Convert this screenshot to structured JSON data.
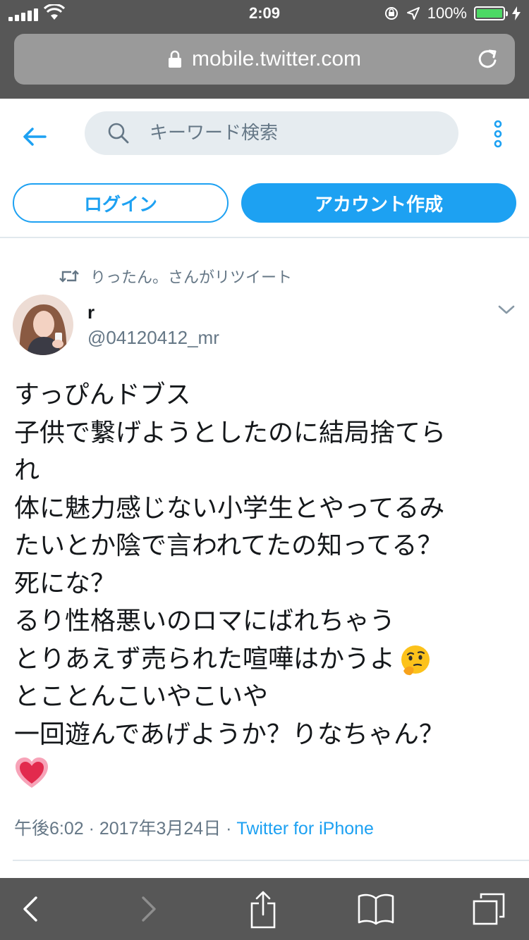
{
  "status_bar": {
    "time": "2:09",
    "battery": "100%"
  },
  "browser": {
    "url": "mobile.twitter.com"
  },
  "header": {
    "search_placeholder": "キーワード検索",
    "login_label": "ログイン",
    "signup_label": "アカウント作成"
  },
  "tweet": {
    "retweet_context": "りったん。さんがリツイート",
    "author_name": "r",
    "author_handle": "@04120412_mr",
    "lines": [
      "すっぴんドブス",
      "子供で繋げようとしたのに結局捨てら",
      "れ",
      "体に魅力感じない小学生とやってるみ",
      "たいとか陰で言われてたの知ってる？",
      "死にな？",
      "るり性格悪いのロマにばれちゃう",
      "とりあえず売られた喧嘩はかうよ",
      "とことんこいやこいや",
      "一回遊んであげようか？りなちゃん？"
    ],
    "emojis": [
      "thinking-face-emoji",
      "heart-emoji"
    ],
    "timestamp": "午後6:02 · 2017年3月24日 · ",
    "source": "Twitter for iPhone"
  },
  "colors": {
    "accent": "#1da1f2",
    "chrome": "#575757",
    "muted": "#657786"
  }
}
